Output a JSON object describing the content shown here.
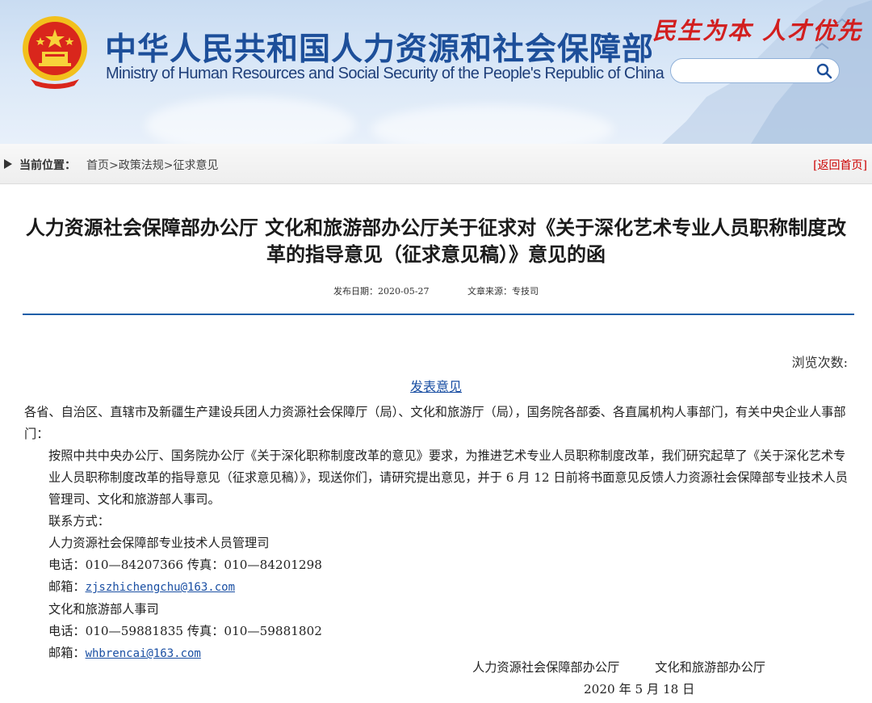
{
  "header": {
    "title_cn": "中华人民共和国人力资源和社会保障部",
    "title_en": "Ministry of Human Resources and Social Security of the People's Republic of China",
    "slogan": "民生为本 人才优先",
    "search": {
      "placeholder": "",
      "value": ""
    },
    "icons": {
      "emblem": "national-emblem-icon",
      "search": "search-icon"
    },
    "colors": {
      "title": "#1d4f9a",
      "slogan": "#d21f1f",
      "banner": "#d9e7f7"
    }
  },
  "location": {
    "label": "当前位置：",
    "breadcrumb": [
      "首页",
      "政策法规",
      "征求意见"
    ],
    "separator": ">",
    "back_home": "返回首页"
  },
  "article": {
    "title": "人力资源社会保障部办公厅 文化和旅游部办公厅关于征求对《关于深化艺术专业人员职称制度改革的指导意见（征求意见稿）》意见的函",
    "publish_date": "发布日期：2020-05-27",
    "source": "文章来源：专技司",
    "views_label": "浏览次数:",
    "comment_link": "发表意见",
    "salutation": "各省、自治区、直辖市及新疆生产建设兵团人力资源社会保障厅（局）、文化和旅游厅（局），国务院各部委、各直属机构人事部门，有关中央企业人事部门：",
    "body": "按照中共中央办公厅、国务院办公厅《关于深化职称制度改革的意见》要求，为推进艺术专业人员职称制度改革，我们研究起草了《关于深化艺术专业人员职称制度改革的指导意见（征求意见稿）》，现送你们，请研究提出意见，并于 6 月 12 日前将书面意见反馈人力资源社会保障部专业技术人员管理司、文化和旅游部人事司。",
    "contact_label": "联系方式：",
    "contacts": [
      {
        "org": "人力资源社会保障部专业技术人员管理司",
        "phone": "电话：010—84207366 传真：010—84201298",
        "email_label": "邮箱：",
        "email": "zjszhichengchu@163.com"
      },
      {
        "org": "文化和旅游部人事司",
        "phone": "电话：010—59881835 传真：010—59881802",
        "email_label": "邮箱：",
        "email": "whbrencai@163.com"
      }
    ],
    "signers": [
      "人力资源社会保障部办公厅",
      "文化和旅游部办公厅"
    ],
    "sign_date": "2020 年 5 月 18 日",
    "colors": {
      "link": "#1a4fa3",
      "divider": "#1f5ea8"
    }
  }
}
